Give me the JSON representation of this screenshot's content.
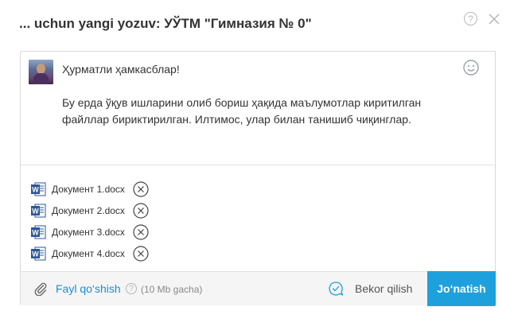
{
  "dialog": {
    "title": "... uchun yangi yozuv: УЎТМ \"Гимназия № 0\"",
    "help_glyph": "?"
  },
  "message": {
    "greeting": "Ҳурматли ҳамкасблар!",
    "body": "Бу ерда ўқув ишларини олиб бориш ҳақида маълумотлар киритилган файллар бириктирилган. Илтимос, улар билан танишиб чиқинглар."
  },
  "attachments": [
    {
      "name": "Документ 1.docx",
      "icon": "word-icon"
    },
    {
      "name": "Документ 2.docx",
      "icon": "word-icon"
    },
    {
      "name": "Документ 3.docx",
      "icon": "word-icon"
    },
    {
      "name": "Документ 4.docx",
      "icon": "word-icon"
    }
  ],
  "footer": {
    "attach_label": "Fayl qo‘shish",
    "info_glyph": "?",
    "size_hint": "(10 Mb gacha)",
    "cancel_label": "Bekor qilish",
    "send_label": "Jo‘natish"
  },
  "colors": {
    "accent": "#1ea0dd",
    "link": "#1a8fd1",
    "word_blue": "#2b5797"
  }
}
